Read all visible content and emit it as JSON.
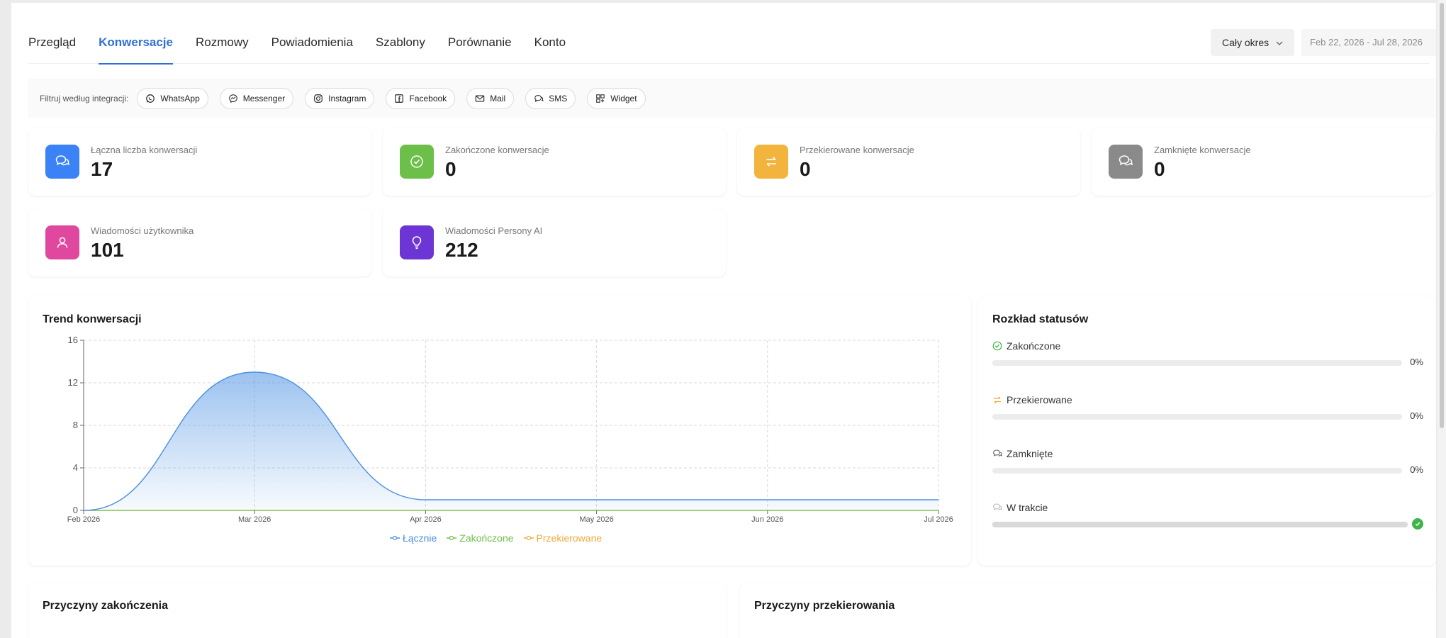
{
  "nav": {
    "tabs": [
      {
        "label": "Przegląd"
      },
      {
        "label": "Konwersacje"
      },
      {
        "label": "Rozmowy"
      },
      {
        "label": "Powiadomienia"
      },
      {
        "label": "Szablony"
      },
      {
        "label": "Porównanie"
      },
      {
        "label": "Konto"
      }
    ],
    "active_tab": "Konwersacje",
    "period_label": "Cały okres",
    "date_range": "Feb 22, 2026 - Jul 28, 2026"
  },
  "filter": {
    "label": "Filtruj według integracji:",
    "chips": [
      {
        "label": "WhatsApp",
        "icon": "whatsapp-icon"
      },
      {
        "label": "Messenger",
        "icon": "messenger-icon"
      },
      {
        "label": "Instagram",
        "icon": "instagram-icon"
      },
      {
        "label": "Facebook",
        "icon": "facebook-icon"
      },
      {
        "label": "Mail",
        "icon": "mail-icon"
      },
      {
        "label": "SMS",
        "icon": "sms-icon"
      },
      {
        "label": "Widget",
        "icon": "widget-icon"
      }
    ]
  },
  "stats": [
    {
      "label": "Łączna liczba konwersacji",
      "value": "17",
      "icon": "chat-bubbles-icon",
      "color": "#3b82f6"
    },
    {
      "label": "Zakończone konwersacje",
      "value": "0",
      "icon": "check-circle-icon",
      "color": "#6cc04a"
    },
    {
      "label": "Przekierowane konwersacje",
      "value": "0",
      "icon": "transfer-arrows-icon",
      "color": "#f2b43c"
    },
    {
      "label": "Zamknięte konwersacje",
      "value": "0",
      "icon": "chat-closed-icon",
      "color": "#8a8a8a"
    },
    {
      "label": "Wiadomości użytkownika",
      "value": "101",
      "icon": "user-icon",
      "color": "#e0479e"
    },
    {
      "label": "Wiadomości Persony AI",
      "value": "212",
      "icon": "lightbulb-icon",
      "color": "#6d35d4"
    }
  ],
  "trend": {
    "title": "Trend konwersacji",
    "legend": [
      {
        "label": "Łącznie",
        "color": "#4a90e2"
      },
      {
        "label": "Zakończone",
        "color": "#6cc04a"
      },
      {
        "label": "Przekierowane",
        "color": "#f2a93b"
      }
    ]
  },
  "chart_data": {
    "type": "area",
    "x": [
      "Feb 2026",
      "Mar 2026",
      "Apr 2026",
      "May 2026",
      "Jun 2026",
      "Jul 2026"
    ],
    "series": [
      {
        "name": "Łącznie",
        "values": [
          0,
          13,
          1,
          1,
          1,
          1
        ]
      },
      {
        "name": "Zakończone",
        "values": [
          0,
          0,
          0,
          0,
          0,
          0
        ]
      },
      {
        "name": "Przekierowane",
        "values": [
          0,
          0,
          0,
          0,
          0,
          0
        ]
      }
    ],
    "ylim": [
      0,
      16
    ],
    "yticks": [
      "0",
      "4",
      "8",
      "12",
      "16"
    ],
    "grid": true,
    "legend_position": "bottom"
  },
  "status": {
    "title": "Rozkład statusów",
    "items": [
      {
        "label": "Zakończone",
        "value": "0%",
        "fraction": 0,
        "icon": "check-circle-icon",
        "color": "#3fb44a"
      },
      {
        "label": "Przekierowane",
        "value": "0%",
        "fraction": 0,
        "icon": "transfer-arrows-icon",
        "color": "#f2a93b"
      },
      {
        "label": "Zamknięte",
        "value": "0%",
        "fraction": 0,
        "icon": "chat-closed-icon",
        "color": "#777777"
      },
      {
        "label": "W trakcie",
        "fraction": 1,
        "icon": "chat-progress-icon",
        "color": "#bbbbbb"
      }
    ]
  },
  "reasons": {
    "end_title": "Przyczyny zakończenia",
    "redirect_title": "Przyczyny przekierowania"
  }
}
